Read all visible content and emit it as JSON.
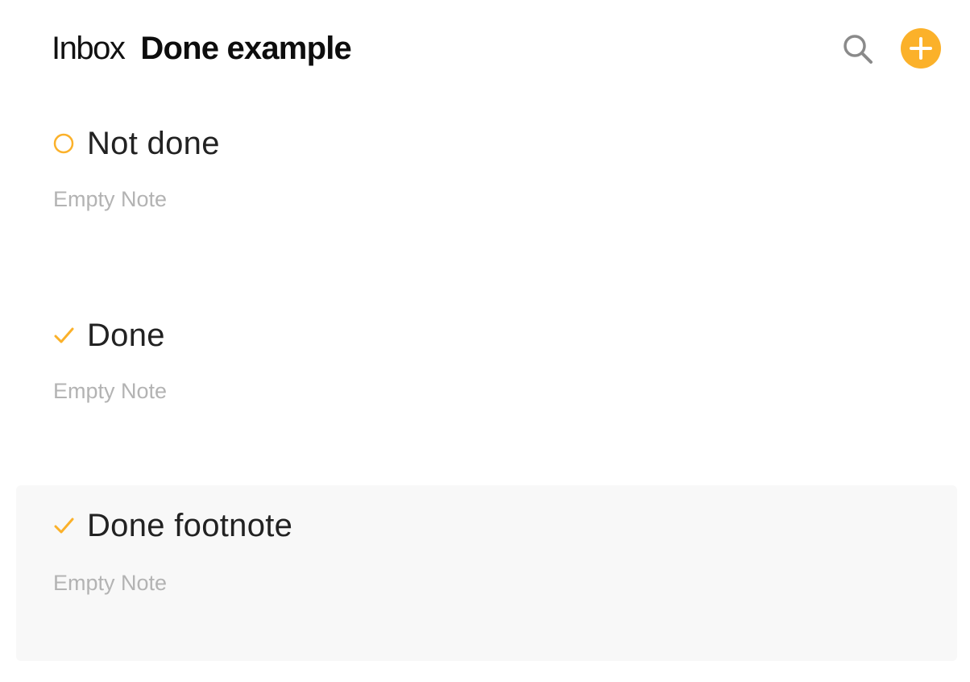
{
  "header": {
    "crumb": "Inbox",
    "title": "Done example"
  },
  "colors": {
    "accent": "#fbb12a",
    "icon_gray": "#8a8a8a",
    "selected_bg": "#f8f8f8"
  },
  "icons": {
    "search": "search-icon",
    "add": "plus-icon",
    "not_done": "circle-icon",
    "done": "checkmark-icon"
  },
  "notes": [
    {
      "title": "Not done",
      "body": "Empty Note",
      "status": "not-done",
      "selected": false
    },
    {
      "title": "Done",
      "body": "Empty Note",
      "status": "done",
      "selected": false
    },
    {
      "title": "Done footnote",
      "body": "Empty Note",
      "status": "done",
      "selected": true
    }
  ]
}
